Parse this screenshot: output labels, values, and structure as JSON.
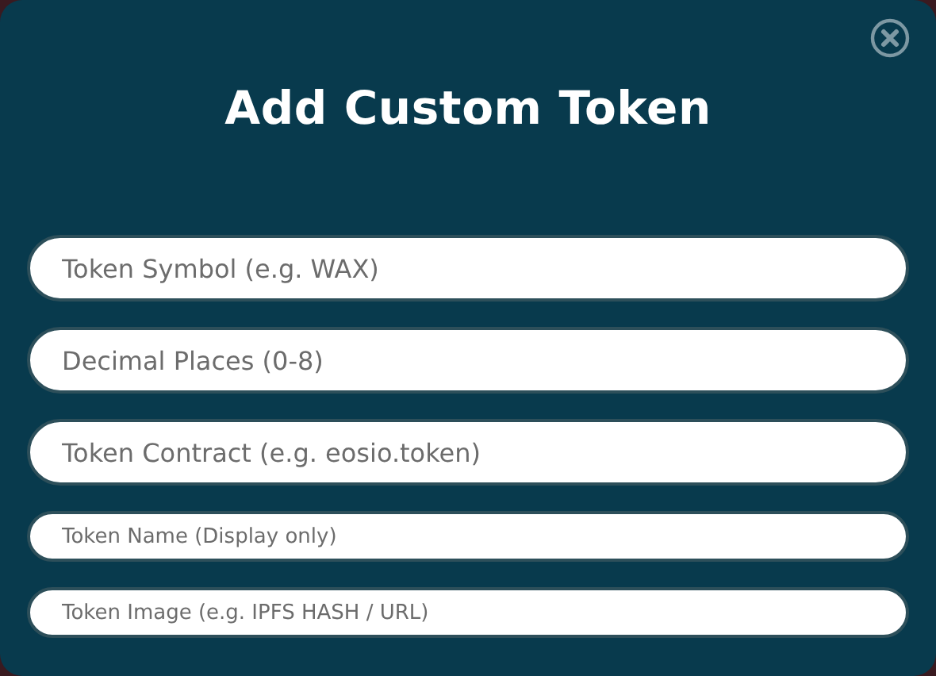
{
  "dialog": {
    "title": "Add Custom Token"
  },
  "fields": [
    {
      "placeholder": "Token Symbol (e.g. WAX)",
      "kind": "large"
    },
    {
      "placeholder": "Decimal Places (0-8)",
      "kind": "large"
    },
    {
      "placeholder": "Token Contract (e.g. eosio.token)",
      "kind": "large"
    },
    {
      "placeholder": "Token Name (Display only)",
      "kind": "small"
    },
    {
      "placeholder": "Token Image (e.g. IPFS HASH / URL)",
      "kind": "small"
    }
  ]
}
